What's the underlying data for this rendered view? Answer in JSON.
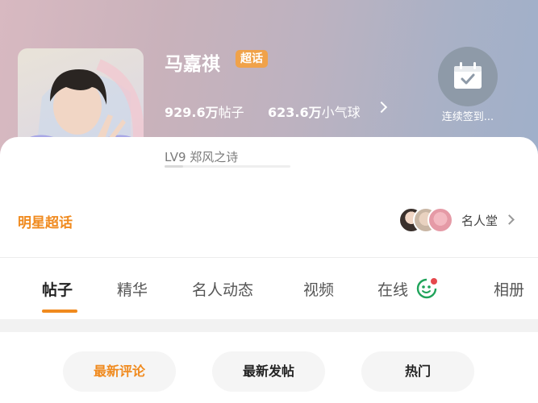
{
  "header": {
    "name": "马嘉祺",
    "badge": "超话",
    "stats": [
      {
        "value": "929.6万",
        "label": "帖子"
      },
      {
        "value": "623.6万",
        "label": "小气球"
      }
    ],
    "checkin_label": "连续签到...",
    "level_text": "LV9 郑风之诗",
    "level_progress": 0.15
  },
  "section": {
    "title": "明星超话",
    "fame_label": "名人堂"
  },
  "tabs": [
    {
      "label": "帖子",
      "active": true
    },
    {
      "label": "精华"
    },
    {
      "label": "名人动态"
    },
    {
      "label": "视频"
    },
    {
      "label": "在线"
    },
    {
      "label": "相册"
    }
  ],
  "sort_buttons": [
    {
      "label": "最新评论",
      "active": true
    },
    {
      "label": "最新发帖"
    },
    {
      "label": "热门"
    }
  ],
  "colors": {
    "accent": "#f08a1e",
    "badge": "#f0a24a"
  }
}
